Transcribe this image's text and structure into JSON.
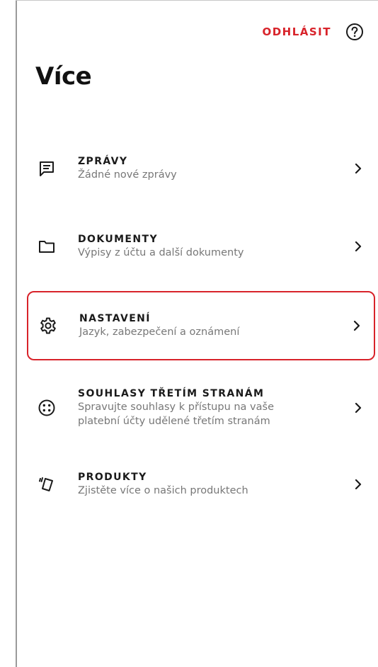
{
  "header": {
    "logout_label": "ODHLÁSIT",
    "help_icon": "help-circle-icon"
  },
  "page": {
    "title": "Více"
  },
  "menu": {
    "items": [
      {
        "id": "messages",
        "icon": "message-icon",
        "title": "ZPRÁVY",
        "subtitle": "Žádné nové zprávy",
        "selected": false
      },
      {
        "id": "documents",
        "icon": "folder-icon",
        "title": "DOKUMENTY",
        "subtitle": "Výpisy z účtu a další dokumenty",
        "selected": false
      },
      {
        "id": "settings",
        "icon": "gear-icon",
        "title": "NASTAVENÍ",
        "subtitle": "Jazyk, zabezpečení a oznámení",
        "selected": true
      },
      {
        "id": "consents",
        "icon": "consent-icon",
        "title": "SOUHLASY TŘETÍM STRANÁM",
        "subtitle_lines": [
          "Spravujte souhlasy k přístupu na vaše",
          "platební účty udělené třetím stranám"
        ],
        "selected": false
      },
      {
        "id": "products",
        "icon": "cards-icon",
        "title": "PRODUKTY",
        "subtitle": "Zjistěte více o našich produktech",
        "selected": false
      }
    ]
  },
  "colors": {
    "accent": "#d8232a",
    "text": "#1a1a1a",
    "muted": "#777777"
  }
}
